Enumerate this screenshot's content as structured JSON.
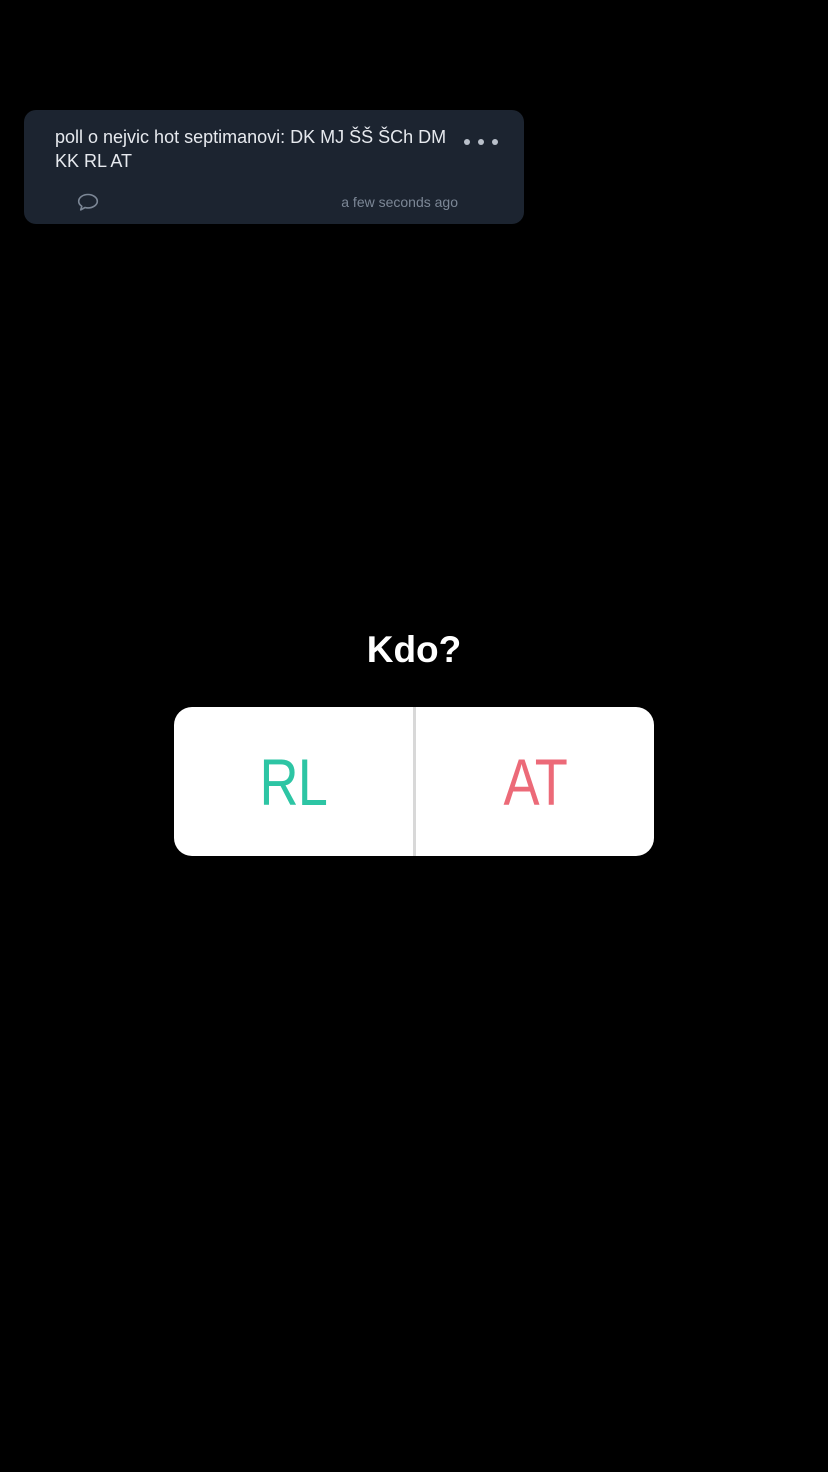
{
  "post": {
    "text": "poll o nejvic hot septimanovi: DK MJ ŠŠ ŠCh DM KK RL AT",
    "timestamp": "a few seconds ago",
    "more_icon": "more-horizontal-icon",
    "comment_icon": "comment-bubble-icon"
  },
  "poll": {
    "question": "Kdo?",
    "options": [
      {
        "label": "RL",
        "color": "#2dc5a4"
      },
      {
        "label": "AT",
        "color": "#ec6a78"
      }
    ]
  },
  "colors": {
    "background": "#000000",
    "card": "#1c2430",
    "card_text": "#e6e9ee",
    "muted": "#7c8796",
    "poll_box": "#ffffff"
  }
}
